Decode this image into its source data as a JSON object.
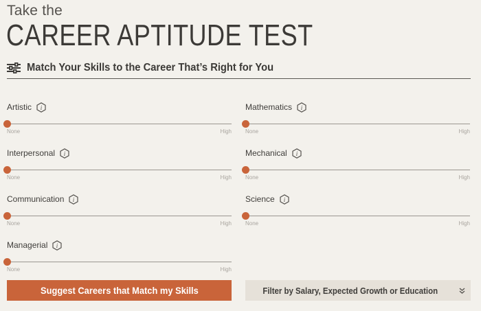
{
  "header": {
    "kicker": "Take the",
    "title": "CAREER APTITUDE TEST",
    "subtitle": "Match Your Skills to the Career That’s Right for You",
    "subtitle_icon": "sliders-icon"
  },
  "scale": {
    "low": "None",
    "high": "High"
  },
  "skills_left": [
    {
      "label": "Artistic",
      "level": 0
    },
    {
      "label": "Interpersonal",
      "level": 0
    },
    {
      "label": "Communication",
      "level": 0
    },
    {
      "label": "Managerial",
      "level": 0
    }
  ],
  "skills_right": [
    {
      "label": "Mathematics",
      "level": 0
    },
    {
      "label": "Mechanical",
      "level": 0
    },
    {
      "label": "Science",
      "level": 0
    }
  ],
  "actions": {
    "suggest_label": "Suggest Careers that Match my Skills",
    "filter_label": "Filter by Salary, Expected Growth or Education",
    "filter_icon": "chevron-double-down-icon"
  },
  "colors": {
    "accent": "#c9643a",
    "background": "#f3f1ec",
    "filter_bg": "#e6e1d9"
  }
}
